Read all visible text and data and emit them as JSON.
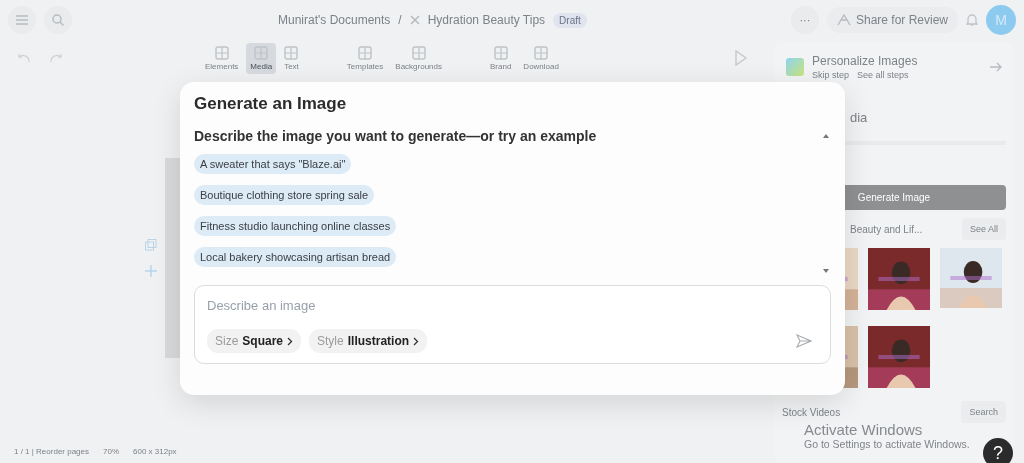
{
  "topbar": {
    "breadcrumb": [
      {
        "label": "Munirat's Documents"
      },
      {
        "label": "Hydration Beauty Tips"
      }
    ],
    "separator": "/",
    "status_badge": "Draft",
    "more": "···",
    "share_button": "Share for Review",
    "avatar": "M"
  },
  "toolbar": {
    "tools": [
      {
        "label": "Elements",
        "selected": false
      },
      {
        "label": "Media",
        "selected": true
      },
      {
        "label": "Text",
        "selected": false
      },
      {
        "label": "Templates",
        "selected": false
      },
      {
        "label": "Backgrounds",
        "selected": false
      },
      {
        "label": "Brand",
        "selected": false
      },
      {
        "label": "Download",
        "selected": false
      }
    ]
  },
  "right_panel": {
    "onboarding": {
      "title": "Personalize Images",
      "skip": "Skip step",
      "see_all": "See all steps"
    },
    "heading": "dia",
    "generate_button": "Generate Image",
    "section_title": "Beauty and Lif...",
    "see_all_button": "See All",
    "stock_title": "Stock Videos",
    "search_button": "Search"
  },
  "status_bar": {
    "pages": "1 / 1 | Reorder pages",
    "zoom": "70%",
    "size": "600 x 312px"
  },
  "dialog": {
    "title": "Generate an Image",
    "subtitle": "Describe the image you want to generate—or try an example",
    "examples": [
      "A sweater that says \"Blaze.ai\"",
      "Boutique clothing store spring sale",
      "Fitness studio launching online classes",
      "Local bakery showcasing artisan bread"
    ],
    "prompt": {
      "placeholder": "Describe an image"
    },
    "options": [
      {
        "label": "Size",
        "value": "Square"
      },
      {
        "label": "Style",
        "value": "Illustration"
      }
    ]
  },
  "windows_notice": {
    "title": "Activate Windows",
    "text": "Go to Settings to activate Windows."
  },
  "help_button": "?"
}
